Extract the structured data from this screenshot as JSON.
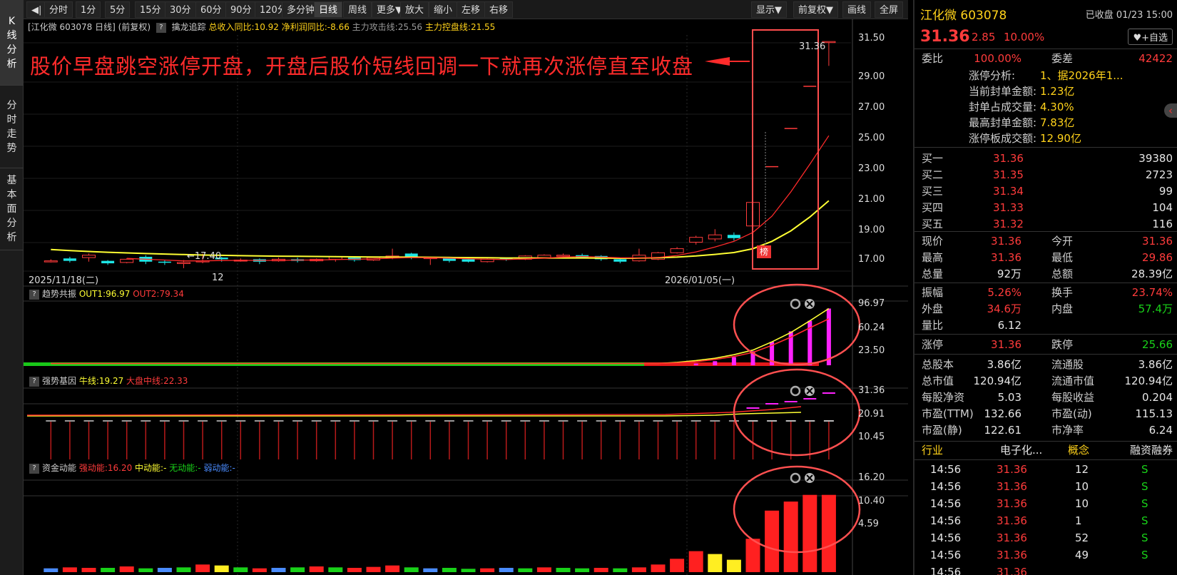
{
  "lefttabs": [
    "K线分析",
    "分时走势",
    "基本面分析"
  ],
  "toolbar": {
    "items": [
      "◀|",
      "分时",
      "1分",
      "5分",
      "15分",
      "30分",
      "60分",
      "90分",
      "120分",
      "多分钟",
      "日线",
      "周线",
      "更多▼",
      "放大",
      "缩小",
      "左移",
      "右移"
    ],
    "right": [
      "显示▼",
      "前复权▼",
      "画线",
      "全屏"
    ]
  },
  "chart_header": {
    "name": "[江化微 603078 日线]",
    "adj": "(前复权)",
    "q": "?",
    "indicator": "擒龙追踪",
    "s1": "总收入同比:10.92",
    "s2": "净利润同比:-8.66",
    "s3": "主力攻击线:25.56",
    "s4": "主力控盘线:21.55"
  },
  "annotation": "股价早盘跳空涨停开盘，开盘后股价短线回调一下就再次涨停直至收盘",
  "main_axis": [
    "31.50",
    "29.00",
    "27.00",
    "25.00",
    "23.00",
    "21.00",
    "19.00",
    "17.00"
  ],
  "price_labels": {
    "high": "31.36",
    "low": "17.40",
    "rank": "榜"
  },
  "dates": [
    "2025/11/18(二)",
    "12",
    "2026/01/05(一)"
  ],
  "chart_data": [
    {
      "type": "candlestick",
      "title": "",
      "ylim": [
        17,
        31.5
      ],
      "candles": [
        [
          17.85,
          17.85,
          17.75,
          17.95
        ],
        [
          18.0,
          17.85,
          17.75,
          18.1
        ],
        [
          18.05,
          18.2,
          17.8,
          18.3
        ],
        [
          17.85,
          17.7,
          17.6,
          17.9
        ],
        [
          17.75,
          17.95,
          17.7,
          18.0
        ],
        [
          18.1,
          17.8,
          17.65,
          18.2
        ],
        [
          17.8,
          17.75,
          17.6,
          17.9
        ],
        [
          17.75,
          17.75,
          17.4,
          17.9
        ],
        [
          17.8,
          17.85,
          17.7,
          18.3
        ],
        [
          18.05,
          17.95,
          17.8,
          18.1
        ],
        [
          17.85,
          17.9,
          17.8,
          18.0
        ],
        [
          17.95,
          17.8,
          17.65,
          18.0
        ],
        [
          17.85,
          17.95,
          17.8,
          18.05
        ],
        [
          17.95,
          17.85,
          17.75,
          18.05
        ],
        [
          17.85,
          17.95,
          17.8,
          18.0
        ],
        [
          17.95,
          18.1,
          17.8,
          18.15
        ],
        [
          18.05,
          17.9,
          17.8,
          18.1
        ],
        [
          17.9,
          18.05,
          17.85,
          18.1
        ],
        [
          18.05,
          18.15,
          17.95,
          18.6
        ],
        [
          18.3,
          18.1,
          17.95,
          18.35
        ],
        [
          18.0,
          18.05,
          17.6,
          18.1
        ],
        [
          18.05,
          17.85,
          17.75,
          18.1
        ],
        [
          17.95,
          17.8,
          17.75,
          18.0
        ],
        [
          17.8,
          17.95,
          17.75,
          18.0
        ],
        [
          18.0,
          17.95,
          17.85,
          18.05
        ],
        [
          17.95,
          18.15,
          17.9,
          18.2
        ],
        [
          18.05,
          18.2,
          18.0,
          18.25
        ],
        [
          18.15,
          18.2,
          18.05,
          18.3
        ],
        [
          18.2,
          18.05,
          18.0,
          18.3
        ],
        [
          18.15,
          17.95,
          17.85,
          18.2
        ],
        [
          17.95,
          17.8,
          17.7,
          18.0
        ],
        [
          17.85,
          18.2,
          17.8,
          18.6
        ],
        [
          17.95,
          18.35,
          17.9,
          18.4
        ],
        [
          18.35,
          18.6,
          18.3,
          18.7
        ],
        [
          19.0,
          19.3,
          18.85,
          19.4
        ],
        [
          19.2,
          19.45,
          19.05,
          19.8
        ],
        [
          19.45,
          19.25,
          19.1,
          19.6
        ],
        [
          20.0,
          21.45,
          19.95,
          21.6
        ],
        [
          23.65,
          23.65,
          23.65,
          23.65
        ],
        [
          26.0,
          26.0,
          26.0,
          26.0
        ],
        [
          28.6,
          28.6,
          28.6,
          28.6
        ],
        [
          31.36,
          31.36,
          29.86,
          31.36
        ]
      ],
      "ma": [
        {
          "name": "",
          "color": "#ffff33",
          "values": [
            18.55,
            18.48,
            18.43,
            18.38,
            18.34,
            18.3,
            18.27,
            18.24,
            18.21,
            18.19,
            18.17,
            18.15,
            18.14,
            18.13,
            18.12,
            18.11,
            18.1,
            18.09,
            18.08,
            18.08,
            18.07,
            18.06,
            18.05,
            18.04,
            18.03,
            18.03,
            18.03,
            18.03,
            18.03,
            18.02,
            18.01,
            18.02,
            18.04,
            18.08,
            18.15,
            18.25,
            18.36,
            18.6,
            19.05,
            19.7,
            20.55,
            21.55
          ]
        },
        {
          "name": "",
          "color": "#ff2a2a",
          "values": [
            null,
            null,
            null,
            null,
            18.0,
            17.95,
            17.9,
            17.85,
            17.85,
            17.87,
            17.88,
            17.88,
            17.88,
            17.9,
            17.9,
            17.93,
            17.95,
            17.97,
            18.02,
            18.05,
            18.04,
            18.02,
            17.98,
            17.95,
            17.93,
            17.97,
            18.02,
            18.08,
            18.12,
            18.08,
            18.04,
            18.03,
            18.06,
            18.18,
            18.4,
            18.7,
            19.05,
            19.6,
            20.6,
            22.1,
            23.8,
            25.56
          ]
        }
      ]
    },
    {
      "type": "bar",
      "title": "趋势共振",
      "labels": [
        "OUT1:96.97",
        "OUT2:79.34"
      ],
      "axis": [
        "96.97",
        "60.24",
        "23.50"
      ],
      "ylim": [
        0,
        100
      ],
      "values": [
        0,
        0,
        0,
        0,
        0,
        0,
        0,
        0,
        0,
        0,
        0,
        0,
        0,
        0,
        0,
        0,
        0,
        0,
        0,
        0,
        0,
        0,
        0,
        0,
        0,
        0,
        0,
        0,
        0,
        0,
        0,
        0,
        0,
        0,
        3,
        7,
        14,
        24,
        40,
        58,
        76,
        96.97
      ],
      "out1": [
        3,
        3,
        3,
        3,
        3,
        3,
        3,
        3,
        3,
        3,
        3,
        3,
        3,
        3,
        3,
        3,
        3,
        3,
        3,
        3,
        3,
        3,
        3,
        3,
        3,
        3,
        3,
        3,
        3,
        3,
        3,
        3,
        3,
        5,
        8,
        12,
        18,
        26,
        40,
        56,
        76,
        96.97
      ],
      "out2": [
        3,
        3,
        3,
        3,
        3,
        3,
        3,
        3,
        3,
        3,
        3,
        3,
        3,
        3,
        3,
        3,
        3,
        3,
        3,
        3,
        3,
        3,
        3,
        3,
        3,
        3,
        3,
        3,
        3,
        3,
        3,
        3,
        3,
        4,
        6,
        10,
        15,
        22,
        34,
        48,
        64,
        79.34
      ]
    },
    {
      "type": "bar",
      "title": "强势基因",
      "labels": [
        "牛线:19.27",
        "大盘中线:22.33"
      ],
      "axis": [
        "31.36",
        "20.91",
        "10.45"
      ],
      "ylim": [
        0,
        35
      ],
      "values": [
        22,
        22,
        22,
        22,
        22,
        22,
        22,
        22,
        22,
        22,
        22,
        22,
        22,
        22,
        22,
        22,
        22,
        22,
        22,
        22,
        22,
        22,
        22,
        22,
        22,
        22,
        22,
        22,
        22,
        22,
        22,
        22,
        22,
        22,
        22,
        22,
        22,
        22,
        22,
        22,
        22,
        22
      ]
    },
    {
      "type": "bar",
      "title": "资金动能",
      "labels": [
        "强动能:16.20",
        "中动能:-",
        "无动能:-",
        "弱动能:-"
      ],
      "axis": [
        "16.20",
        "10.40",
        "4.59"
      ],
      "ylim": [
        0,
        17.5
      ],
      "values": [
        0.8,
        1.0,
        0.9,
        0.9,
        1.2,
        0.8,
        0.9,
        1.0,
        1.6,
        1.4,
        1.0,
        0.8,
        0.9,
        1.0,
        1.2,
        1.0,
        0.9,
        1.1,
        1.4,
        1.0,
        0.8,
        0.9,
        0.7,
        0.8,
        0.9,
        0.8,
        1.0,
        0.9,
        0.8,
        0.9,
        0.8,
        1.0,
        1.6,
        2.8,
        4.4,
        3.8,
        2.6,
        7.0,
        12.9,
        14.8,
        16.2,
        16.2
      ]
    }
  ],
  "panel": {
    "title": "江化微 603078",
    "status": "已收盘 01/23 15:00",
    "price": "31.36",
    "chg": "2.85",
    "pct": "10.00%",
    "fav": "♥+自选",
    "wb": {
      "l1": "委比",
      "v1": "100.00%",
      "l2": "委差",
      "v2": "42422"
    },
    "zt": [
      [
        "涨停分析:",
        "1、据2026年1..."
      ],
      [
        "当前封单金额:",
        "1.23亿"
      ],
      [
        "封单占成交量:",
        "4.30%"
      ],
      [
        "最高封单金额:",
        "7.83亿"
      ],
      [
        "涨停板成交额:",
        "12.90亿"
      ]
    ],
    "bids": [
      [
        "买一",
        "31.36",
        "39380"
      ],
      [
        "买二",
        "31.35",
        "2723"
      ],
      [
        "买三",
        "31.34",
        "99"
      ],
      [
        "买四",
        "31.33",
        "104"
      ],
      [
        "买五",
        "31.32",
        "116"
      ]
    ],
    "q1": [
      [
        "现价",
        "31.36",
        "今开",
        "31.36"
      ],
      [
        "最高",
        "31.36",
        "最低",
        "29.86"
      ],
      [
        "总量",
        "92万",
        "总额",
        "28.39亿"
      ]
    ],
    "q2": [
      [
        "振幅",
        "5.26%",
        "换手",
        "23.74%"
      ],
      [
        "外盘",
        "34.6万",
        "内盘",
        "57.4万"
      ],
      [
        "量比",
        "6.12",
        "",
        ""
      ]
    ],
    "q3": [
      [
        "涨停",
        "31.36",
        "跌停",
        "25.66"
      ]
    ],
    "q4": [
      [
        "总股本",
        "3.86亿",
        "流通股",
        "3.86亿"
      ],
      [
        "总市值",
        "120.94亿",
        "流通市值",
        "120.94亿"
      ],
      [
        "每股净资",
        "5.03",
        "每股收益",
        "0.204"
      ],
      [
        "市盈(TTM)",
        "132.66",
        "市盈(动)",
        "115.13"
      ],
      [
        "市盈(静)",
        "122.61",
        "市净率",
        "6.24"
      ]
    ],
    "sector": [
      "行业",
      "电子化...",
      "概念",
      "融资融券"
    ],
    "ticks": [
      [
        "14:56",
        "31.36",
        "12",
        "S"
      ],
      [
        "14:56",
        "31.36",
        "10",
        "S"
      ],
      [
        "14:56",
        "31.36",
        "10",
        "S"
      ],
      [
        "14:56",
        "31.36",
        "1",
        "S"
      ],
      [
        "14:56",
        "31.36",
        "52",
        "S"
      ],
      [
        "14:56",
        "31.36",
        "49",
        "S"
      ],
      [
        "14:56",
        "31.36",
        "",
        ""
      ]
    ]
  }
}
